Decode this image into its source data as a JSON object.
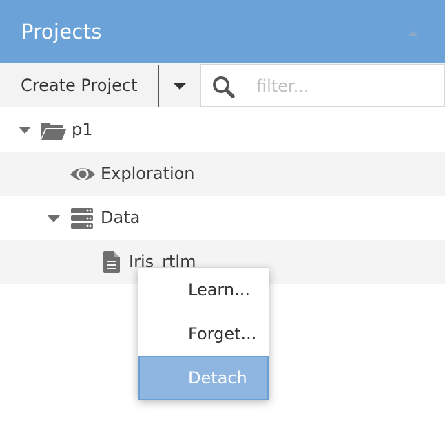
{
  "header": {
    "title": "Projects",
    "collapse_icon": "caret-up-icon"
  },
  "toolbar": {
    "create_label": "Create Project",
    "dropdown_icon": "caret-down-icon",
    "filter_placeholder": "filter...",
    "filter_value": "",
    "search_icon": "search-icon"
  },
  "tree": {
    "project": {
      "label": "p1",
      "icon": "folder-open-icon",
      "expanded": true
    },
    "exploration": {
      "label": "Exploration",
      "icon": "eye-icon"
    },
    "data": {
      "label": "Data",
      "icon": "server-icon",
      "expanded": true
    },
    "file": {
      "label": "Iris_rtlm",
      "icon": "file-icon"
    }
  },
  "context_menu": {
    "items": [
      {
        "label": "Learn..."
      },
      {
        "label": "Forget..."
      },
      {
        "label": "Detach",
        "highlighted": true
      }
    ]
  },
  "colors": {
    "header": "#6ba2d8",
    "menu_highlight": "#8fb6e1",
    "icon": "#6e6e6e"
  }
}
